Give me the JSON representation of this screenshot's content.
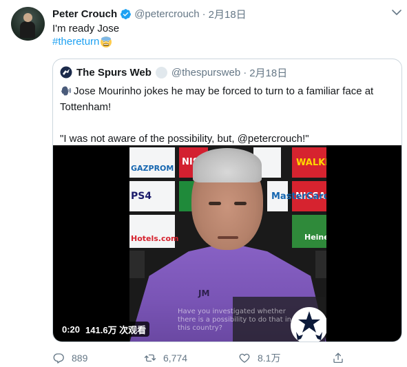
{
  "tweet": {
    "author_name": "Peter Crouch",
    "author_handle": "@petercrouch",
    "separator": "·",
    "date": "2月18日",
    "text_line1": "I'm ready Jose",
    "hashtag": "#thereturn",
    "icons": {
      "verified": "verified-badge-icon",
      "menu": "chevron-down-icon",
      "emoji": "face-emoji-icon"
    }
  },
  "quoted_tweet": {
    "author_name": "The Spurs Web",
    "author_handle": "@thespursweb",
    "separator": "·",
    "date": "2月18日",
    "text_line1": "Jose Mourinho jokes he may be forced to turn to a familiar face at Tottenham!",
    "text_line2": "\"I was not aware of the possibility, but, @petercrouch!\"",
    "icons": {
      "logo": "spurs-logo-icon",
      "emoji": "speaking-head-icon"
    }
  },
  "video": {
    "duration": "0:20",
    "views": "141.6万 次观看",
    "overlay_caption": "Have you investigated whether there is a possibility to do that in this country?",
    "shirt_initials": "JM",
    "sponsor_boards": [
      "GAZPROM",
      "NISSAN",
      "WALKERS",
      "PS4",
      "NISSAN",
      "Hotels.com",
      "Heineken",
      "MasterCard"
    ]
  },
  "actions": {
    "reply_count": "889",
    "retweet_count": "6,774",
    "like_count": "8.1万",
    "icons": {
      "reply": "reply-icon",
      "retweet": "retweet-icon",
      "like": "heart-icon",
      "share": "share-icon"
    }
  },
  "colors": {
    "link": "#1da1f2",
    "muted": "#657786",
    "text": "#14171a",
    "border": "#ccd6dd",
    "verified": "#1da1f2"
  }
}
